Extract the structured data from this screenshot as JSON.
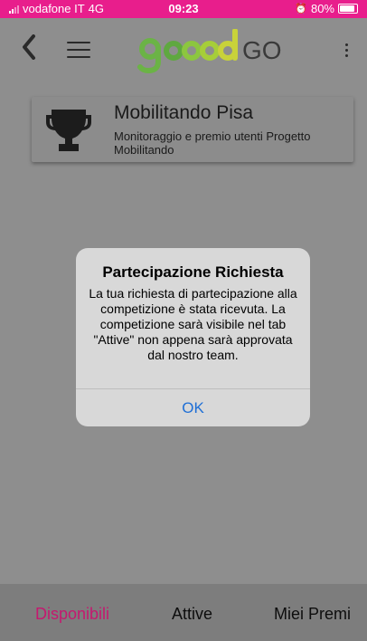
{
  "status_bar": {
    "carrier": "vodafone IT",
    "network": "4G",
    "time": "09:23",
    "battery": "80%"
  },
  "header": {
    "logo_text": "GO"
  },
  "competition": {
    "title": "Mobilitando Pisa",
    "subtitle": "Monitoraggio e premio utenti Progetto Mobilitando"
  },
  "alert": {
    "title": "Partecipazione Richiesta",
    "message": "La tua richiesta di partecipazione alla competizione è stata ricevuta. La competizione sarà visibile nel tab \"Attive\" non appena sarà approvata dal nostro team.",
    "button_label": "OK"
  },
  "tabs": [
    {
      "label": "Disponibili",
      "active": true
    },
    {
      "label": "Attive",
      "active": false
    },
    {
      "label": "Miei Premi",
      "active": false
    }
  ],
  "colors": {
    "brand_pink": "#e81e8c",
    "active_tab": "#c5186f",
    "logo_green": "#6bb346",
    "link_blue": "#1f6fd6"
  }
}
